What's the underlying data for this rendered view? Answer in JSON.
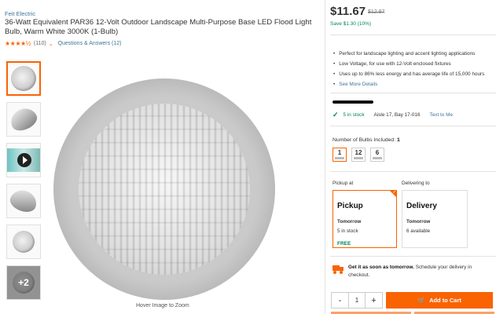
{
  "product": {
    "brand": "Feit Electric",
    "title": "36-Watt Equivalent PAR36 12-Volt Outdoor Landscape Multi-Purpose Base LED Flood Light Bulb, Warm White 3000K (1-Bulb)",
    "rating_stars": "★★★★½",
    "rating_value": 4.5,
    "review_count": "(110)",
    "qa_link": "Questions & Answers (12)",
    "hover_hint": "Hover Image to Zoom",
    "more_images": "+2"
  },
  "pricing": {
    "price": "$11.67",
    "was": "$12.97",
    "save": "Save $1.30 (10%)"
  },
  "highlights": [
    "Perfect for landscape lighting and accent lighting applications",
    "Low Voltage, for use with 12-Volt enclosed fixtures",
    "Uses up to 86% less energy and has average life of 15,000 hours",
    "See More Details"
  ],
  "store": {
    "in_stock": "5 in stock",
    "aisle": "Aisle 17, Bay 17-016",
    "text_me": "Text to Me"
  },
  "bulbs": {
    "label": "Number of Bulbs Included:",
    "selected": "1",
    "options": [
      "1",
      "12",
      "6"
    ]
  },
  "fulfillment": {
    "pickup_label": "Pickup at",
    "delivering_label": "Delivering to",
    "pickup": {
      "title": "Pickup",
      "when": "Tomorrow",
      "stock": "5 in stock",
      "cost": "FREE"
    },
    "delivery": {
      "title": "Delivery",
      "when": "Tomorrow",
      "stock": "6 available"
    }
  },
  "shipping": {
    "bold": "Get it as soon as tomorrow.",
    "rest": "Schedule your delivery in checkout."
  },
  "cart": {
    "minus": "-",
    "quantity": "1",
    "plus": "+",
    "add_to_cart": "Add to Cart"
  },
  "colors": {
    "accent": "#f96302",
    "link": "#3e7697",
    "success": "#00855a"
  }
}
